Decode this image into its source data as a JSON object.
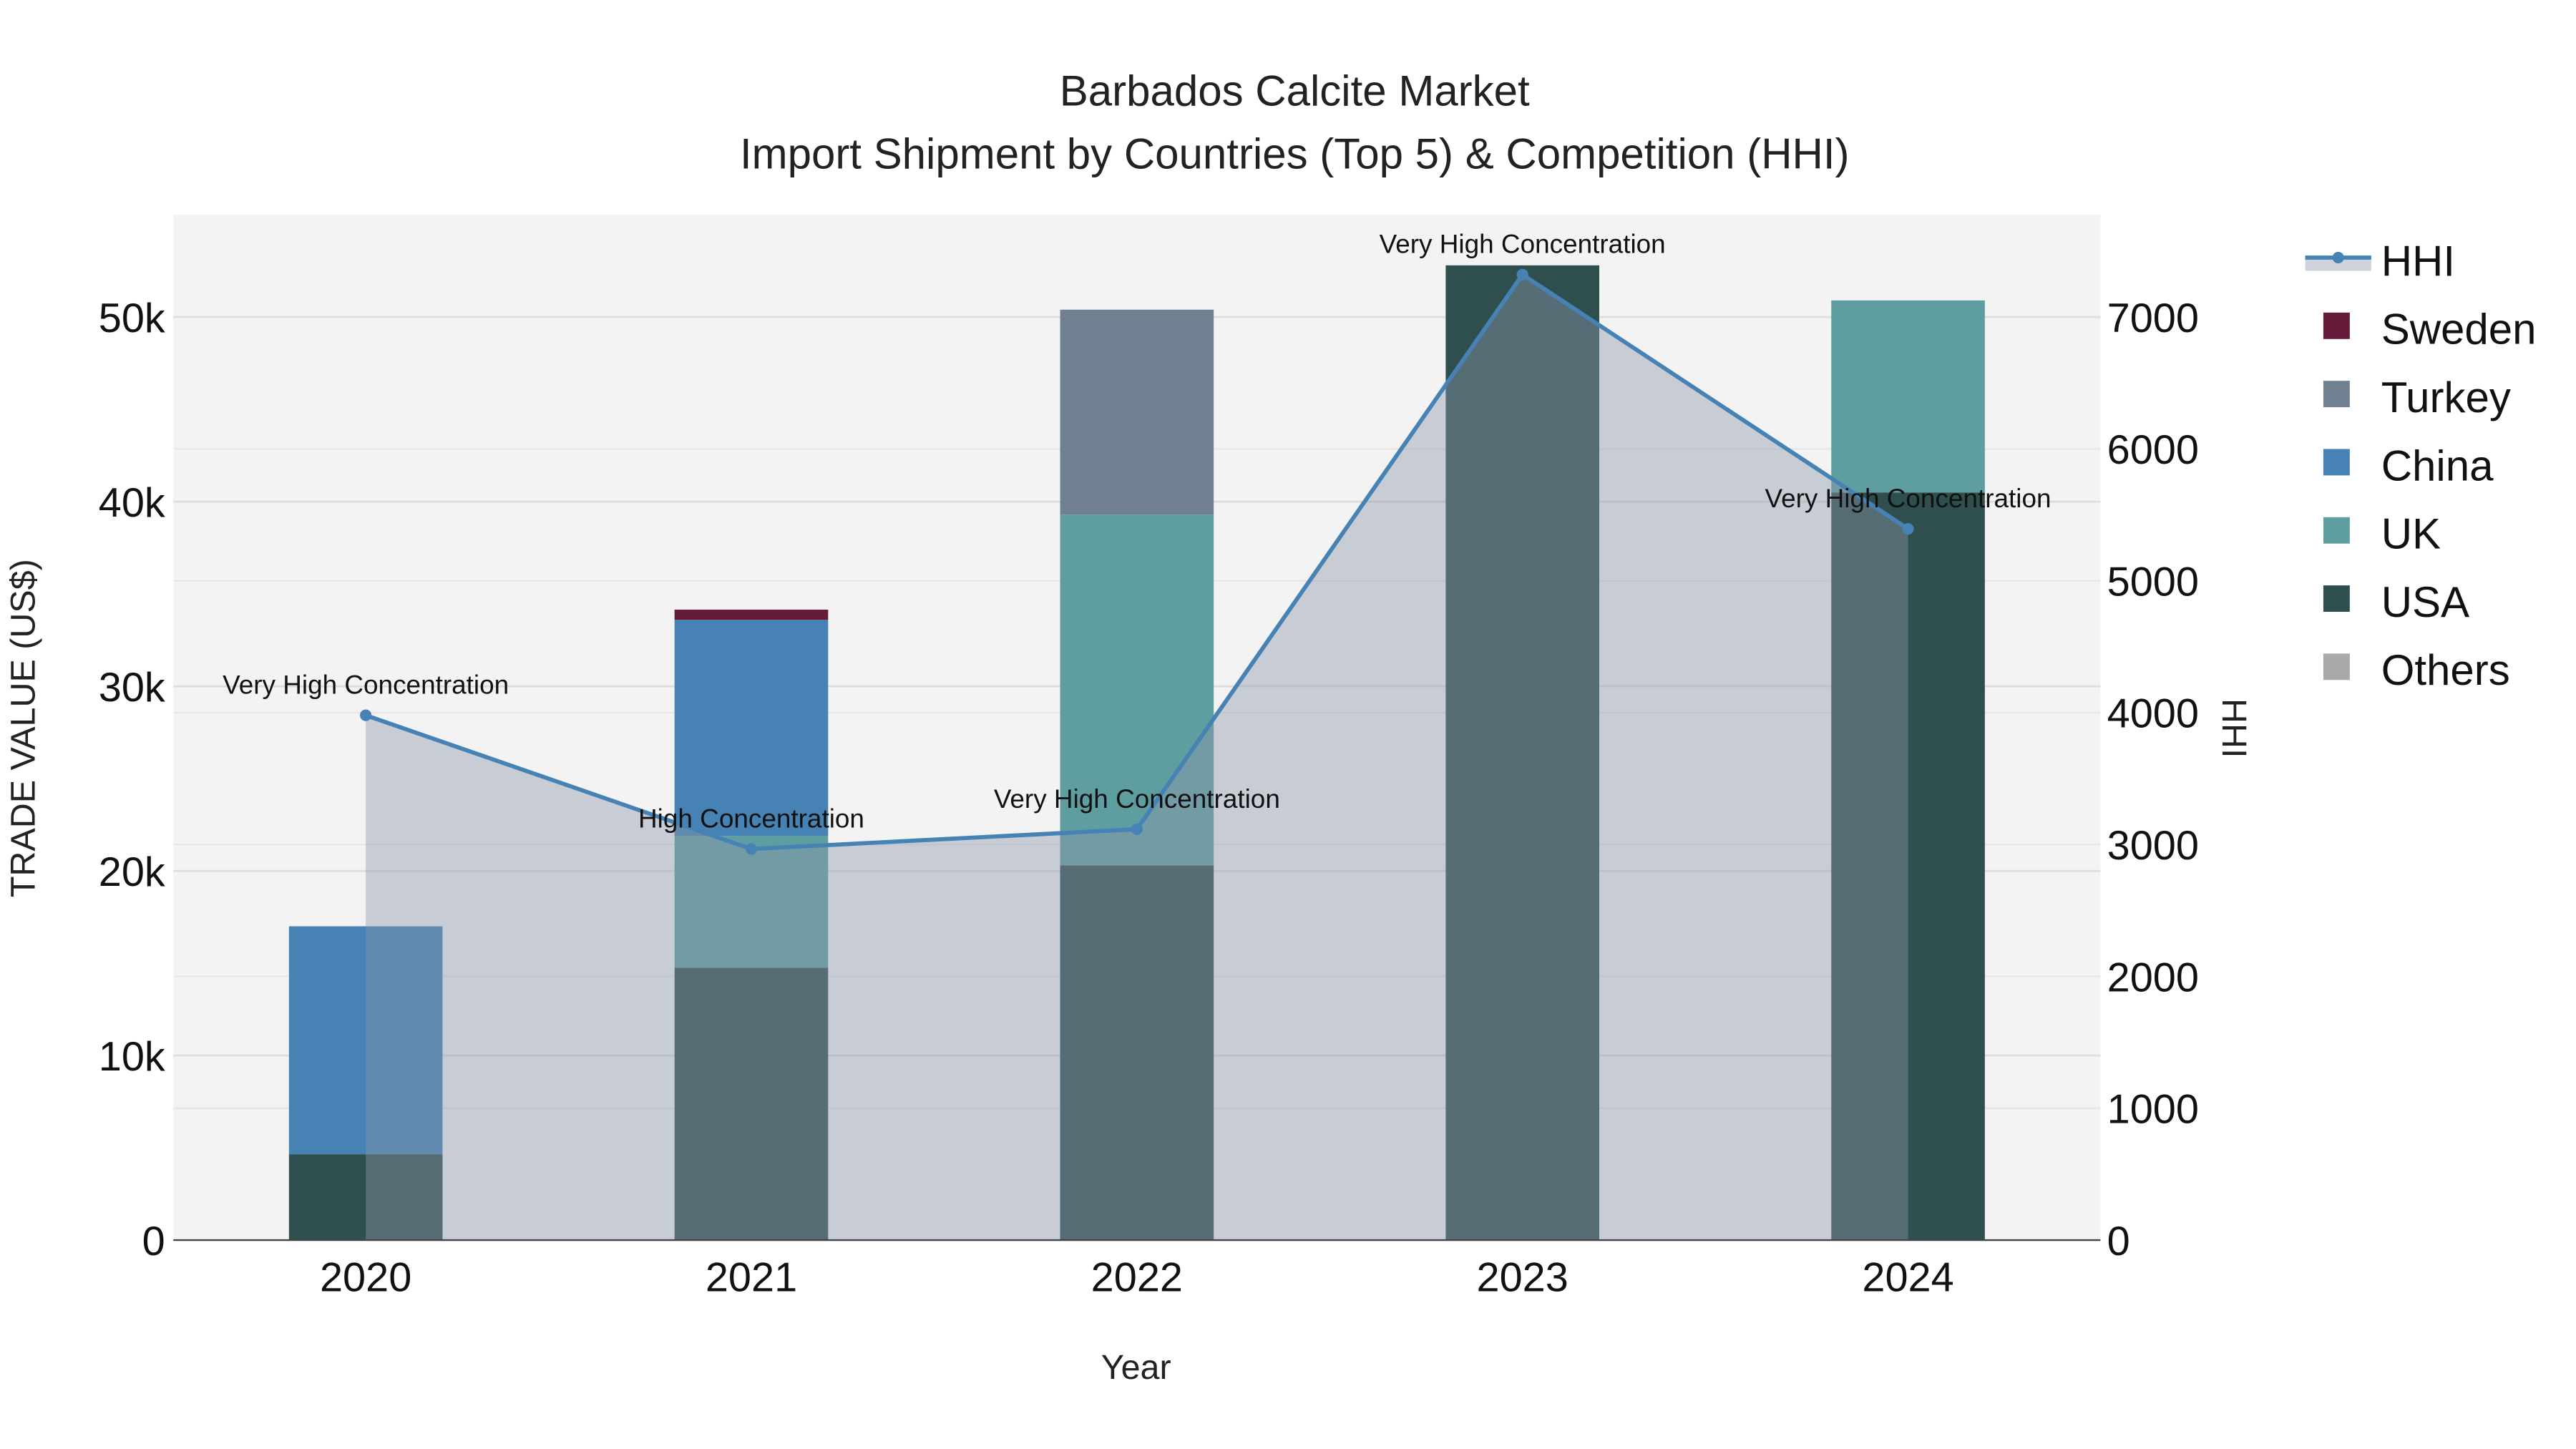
{
  "chart_data": {
    "type": "bar",
    "title": "Barbados Calcite Market",
    "subtitle": "Import Shipment by Countries (Top 5) & Competition (HHI)",
    "xlabel": "Year",
    "ylabel": "TRADE VALUE (US$)",
    "y2label": "HHI",
    "categories": [
      "2020",
      "2021",
      "2022",
      "2023",
      "2024"
    ],
    "ylim": [
      0,
      55500
    ],
    "y2lim": [
      0,
      7770
    ],
    "yticks": [
      0,
      10000,
      20000,
      30000,
      40000,
      50000
    ],
    "ytick_labels": [
      "0",
      "10k",
      "20k",
      "30k",
      "40k",
      "50k"
    ],
    "y2ticks": [
      0,
      1000,
      2000,
      3000,
      4000,
      5000,
      6000,
      7000
    ],
    "y2tick_labels": [
      "0",
      "1000",
      "2000",
      "3000",
      "4000",
      "5000",
      "6000",
      "7000"
    ],
    "grid": true,
    "legend_placement": "right",
    "series": [
      {
        "name": "USA",
        "color": "#2f4f4f",
        "values": [
          4650,
          14750,
          20300,
          52800,
          40500
        ]
      },
      {
        "name": "UK",
        "color": "#5f9ea0",
        "values": [
          0,
          7150,
          19000,
          0,
          10400
        ]
      },
      {
        "name": "China",
        "color": "#4682b4",
        "values": [
          12350,
          11700,
          0,
          0,
          0
        ]
      },
      {
        "name": "Turkey",
        "color": "#708090",
        "values": [
          0,
          0,
          11100,
          0,
          0
        ]
      },
      {
        "name": "Sweden",
        "color": "#661a3a",
        "values": [
          0,
          550,
          0,
          0,
          0
        ]
      },
      {
        "name": "Others",
        "color": "#a9a9a9",
        "values": [
          0,
          0,
          0,
          0,
          0
        ]
      }
    ],
    "hhi": {
      "name": "HHI",
      "color": "#4682b4",
      "values": [
        3980,
        2966,
        3116,
        7322,
        5394
      ],
      "annotations": [
        "Very High Concentration",
        "High Concentration",
        "Very High Concentration",
        "Very High Concentration",
        "Very High Concentration"
      ]
    },
    "legend_order": [
      "HHI",
      "Sweden",
      "Turkey",
      "China",
      "UK",
      "USA",
      "Others"
    ]
  }
}
